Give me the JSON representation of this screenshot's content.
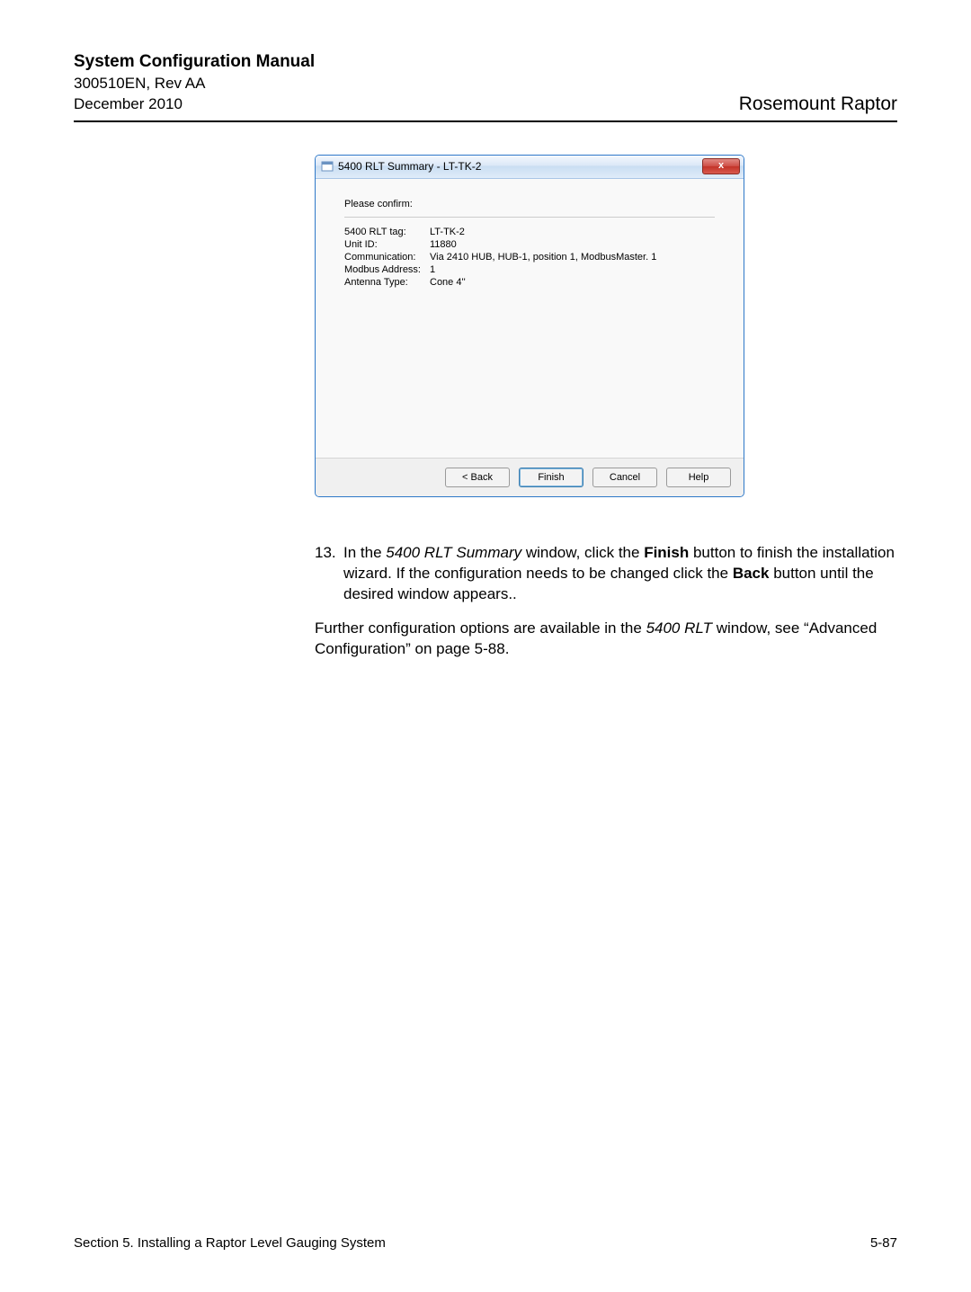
{
  "header": {
    "title": "System Configuration Manual",
    "doc_ref": "300510EN, Rev AA",
    "date": "December 2010",
    "brand": "Rosemount Raptor"
  },
  "dialog": {
    "title": "5400 RLT Summary - LT-TK-2",
    "close_glyph": "x",
    "confirm_label": "Please confirm:",
    "rows": [
      {
        "label": "5400 RLT tag:",
        "value": "LT-TK-2"
      },
      {
        "label": "Unit ID:",
        "value": "11880"
      },
      {
        "label": "Communication:",
        "value": "Via 2410 HUB,  HUB-1,  position  1, ModbusMaster. 1"
      },
      {
        "label": "Modbus Address:",
        "value": "1"
      },
      {
        "label": "Antenna Type:",
        "value": "Cone 4''"
      }
    ],
    "buttons": {
      "back": "< Back",
      "finish": "Finish",
      "cancel": "Cancel",
      "help": "Help"
    }
  },
  "instruction": {
    "num": "13.",
    "t1": "In the ",
    "win_name": "5400 RLT Summary",
    "t2": " window, click the ",
    "btn_finish": "Finish",
    "t3": " button to finish the installation wizard. If the configuration needs to be changed click the ",
    "btn_back": "Back",
    "t4": " button until the desired window appears.."
  },
  "para2": {
    "t1": "Further configuration options are available in the ",
    "win_name": "5400 RLT",
    "t2": " window, see “Advanced Configuration” on page 5-88."
  },
  "footer": {
    "left": "Section 5. Installing a Raptor Level Gauging System",
    "right": "5-87"
  }
}
